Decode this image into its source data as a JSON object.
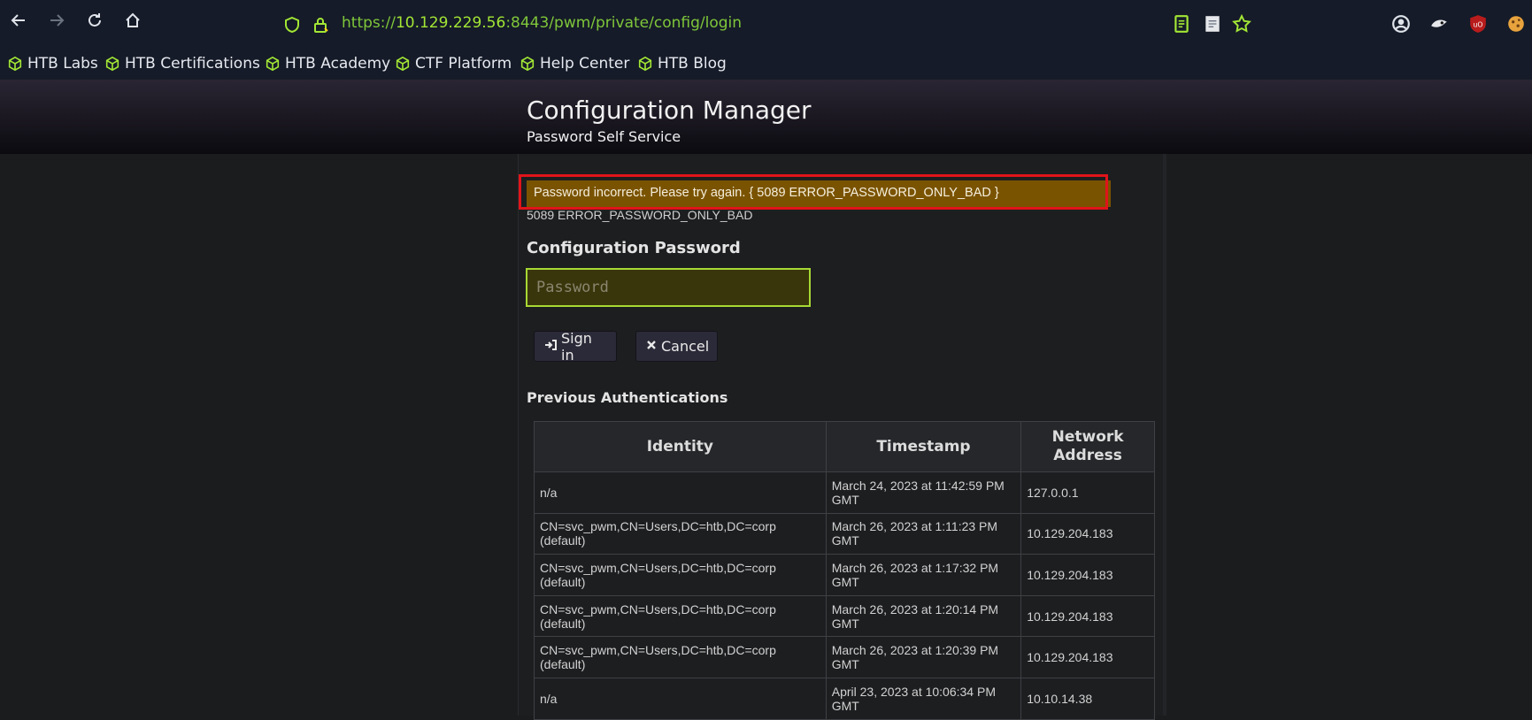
{
  "browser": {
    "url_scheme": "https://",
    "url_host": "10.129.229.56",
    "url_rest": ":8443/pwm/private/config/login",
    "bookmarks": [
      "HTB Labs",
      "HTB Certifications",
      "HTB Academy",
      "CTF Platform",
      "Help Center",
      "HTB Blog"
    ],
    "icons": [
      "back-icon",
      "forward-icon",
      "reload-icon",
      "home-icon",
      "shield-icon",
      "lock-icon",
      "reader-icon",
      "note-icon",
      "star-icon",
      "account-icon",
      "extension-icon",
      "ublock-icon",
      "cookie-icon"
    ],
    "accent": "#a3e635"
  },
  "header": {
    "title": "Configuration Manager",
    "subtitle": "Password Self Service"
  },
  "error": {
    "message": "Password incorrect. Please try again. { 5089 ERROR_PASSWORD_ONLY_BAD }",
    "code": "5089 ERROR_PASSWORD_ONLY_BAD",
    "highlight_color": "#e0141a"
  },
  "login": {
    "label": "Configuration Password",
    "placeholder": "Password",
    "value": "",
    "sign_in_label": "Sign in",
    "cancel_label": "Cancel"
  },
  "history": {
    "title": "Previous Authentications",
    "columns": [
      "Identity",
      "Timestamp",
      "Network Address"
    ],
    "rows": [
      {
        "identity": "n/a",
        "timestamp": "March 24, 2023 at 11:42:59 PM GMT",
        "address": "127.0.0.1"
      },
      {
        "identity": "CN=svc_pwm,CN=Users,DC=htb,DC=corp (default)",
        "timestamp": "March 26, 2023 at 1:11:23 PM GMT",
        "address": "10.129.204.183"
      },
      {
        "identity": "CN=svc_pwm,CN=Users,DC=htb,DC=corp (default)",
        "timestamp": "March 26, 2023 at 1:17:32 PM GMT",
        "address": "10.129.204.183"
      },
      {
        "identity": "CN=svc_pwm,CN=Users,DC=htb,DC=corp (default)",
        "timestamp": "March 26, 2023 at 1:20:14 PM GMT",
        "address": "10.129.204.183"
      },
      {
        "identity": "CN=svc_pwm,CN=Users,DC=htb,DC=corp (default)",
        "timestamp": "March 26, 2023 at 1:20:39 PM GMT",
        "address": "10.129.204.183"
      },
      {
        "identity": "n/a",
        "timestamp": "April 23, 2023 at 10:06:34 PM GMT",
        "address": "10.10.14.38"
      }
    ]
  }
}
